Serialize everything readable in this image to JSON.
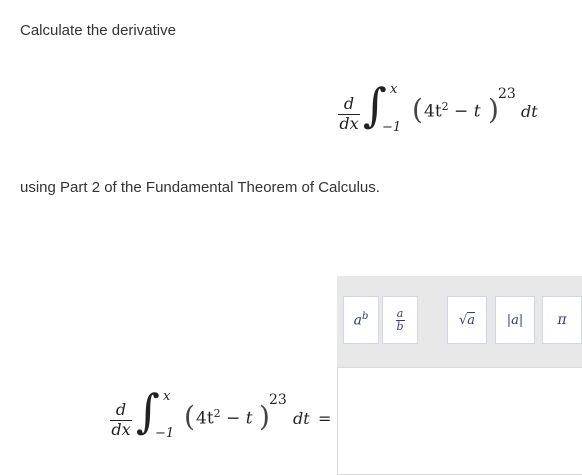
{
  "instructions": {
    "line1": "Calculate the derivative",
    "line2": "using Part 2 of the Fundamental Theorem of Calculus."
  },
  "expression": {
    "d": "d",
    "dx": "dx",
    "upper_limit": "x",
    "lower_limit": "−1",
    "integrand_base": "4t",
    "integrand_base_exp": "2",
    "integrand_rest": " − t",
    "outer_exponent": "23",
    "dt": "dt",
    "equals": "="
  },
  "toolbar": {
    "power_label": "a^b",
    "fraction_label": "a/b",
    "sqrt_label": "√a",
    "abs_label": "|a|",
    "pi_label": "π",
    "power_icon": "power-icon",
    "fraction_icon": "fraction-icon",
    "sqrt_icon": "sqrt-icon",
    "abs_icon": "abs-icon",
    "pi_icon": "pi-icon"
  },
  "answer": {
    "value": ""
  }
}
